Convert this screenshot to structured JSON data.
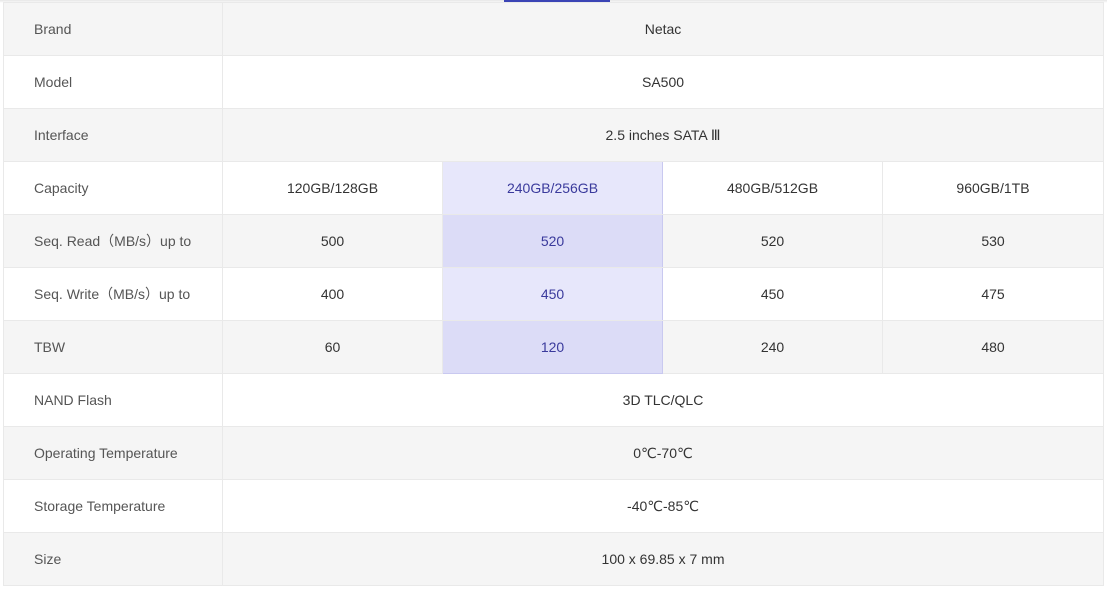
{
  "spec_table": {
    "rows": {
      "brand": {
        "label": "Brand",
        "value": "Netac"
      },
      "model": {
        "label": "Model",
        "value": "SA500"
      },
      "interface": {
        "label": "Interface",
        "value": "2.5 inches SATA Ⅲ"
      },
      "capacity": {
        "label": "Capacity",
        "values": [
          "120GB/128GB",
          "240GB/256GB",
          "480GB/512GB",
          "960GB/1TB"
        ]
      },
      "seq_read": {
        "label": "Seq. Read（MB/s）up to",
        "values": [
          "500",
          "520",
          "520",
          "530"
        ]
      },
      "seq_write": {
        "label": "Seq. Write（MB/s）up to",
        "values": [
          "400",
          "450",
          "450",
          "475"
        ]
      },
      "tbw": {
        "label": "TBW",
        "values": [
          "60",
          "120",
          "240",
          "480"
        ]
      },
      "nand": {
        "label": "NAND Flash",
        "value": "3D TLC/QLC"
      },
      "op_temp": {
        "label": "Operating Temperature",
        "value": "0℃-70℃"
      },
      "storage_temp": {
        "label": "Storage Temperature",
        "value": "-40℃-85℃"
      },
      "size": {
        "label": "Size",
        "value": "100 x 69.85 x 7 mm"
      }
    },
    "highlighted_column": 1,
    "colors": {
      "highlight_bg": "#e7e7fb",
      "highlight_text": "#3a3a9c",
      "tab_indicator": "#3b44b5"
    }
  }
}
